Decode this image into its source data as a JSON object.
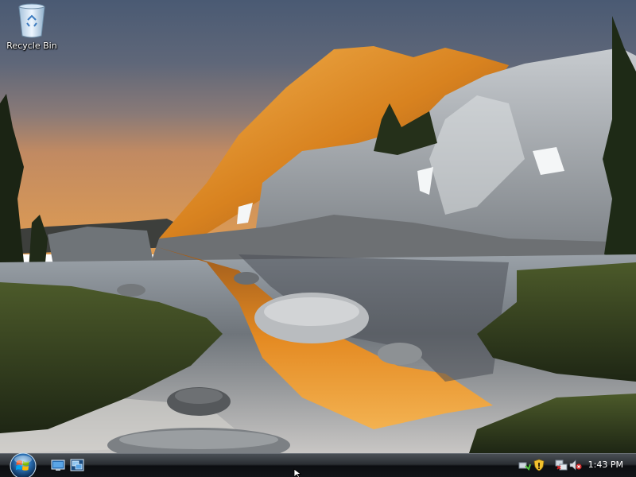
{
  "desktop": {
    "icons": [
      {
        "label": "Recycle Bin",
        "icon": "recycle-bin-icon"
      }
    ]
  },
  "taskbar": {
    "start_button": {
      "icon": "windows-start-orb-icon"
    },
    "quick_launch": [
      {
        "icon": "show-desktop-icon"
      },
      {
        "icon": "switch-windows-icon"
      }
    ],
    "tray": {
      "icons": [
        "network-icon",
        "security-shield-icon",
        "network-status-icon",
        "volume-muted-icon"
      ],
      "clock": "1:43 PM"
    }
  },
  "colors": {
    "taskbar_top": "#4a4f55",
    "taskbar_bottom": "#0c0e11",
    "sky_top": "#4b5c74",
    "sky_bottom": "#d7915a",
    "mountain_glow": "#e3921f"
  }
}
